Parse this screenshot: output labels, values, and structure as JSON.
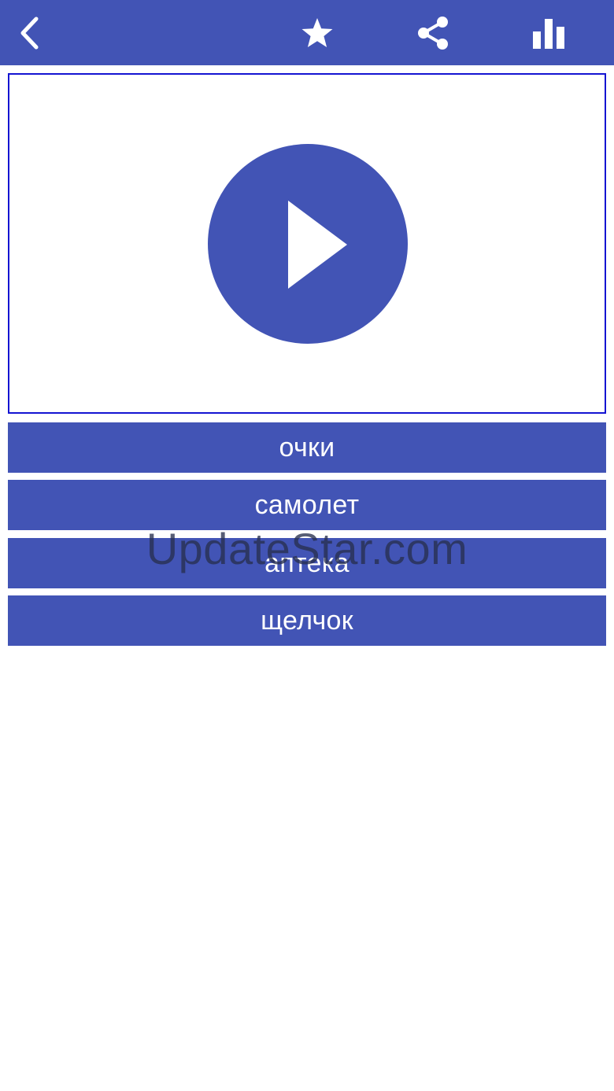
{
  "colors": {
    "primary": "#4254b5",
    "frame_border": "#1414d2",
    "text_on_primary": "#ffffff",
    "background": "#ffffff"
  },
  "toolbar": {
    "icons": [
      "chevron-left-icon",
      "star-icon",
      "share-icon",
      "bar-chart-icon"
    ]
  },
  "player": {
    "icon": "play-icon"
  },
  "answers": [
    "очки",
    "самолет",
    "аптека",
    "щелчок"
  ],
  "watermark": "UpdateStar.com"
}
